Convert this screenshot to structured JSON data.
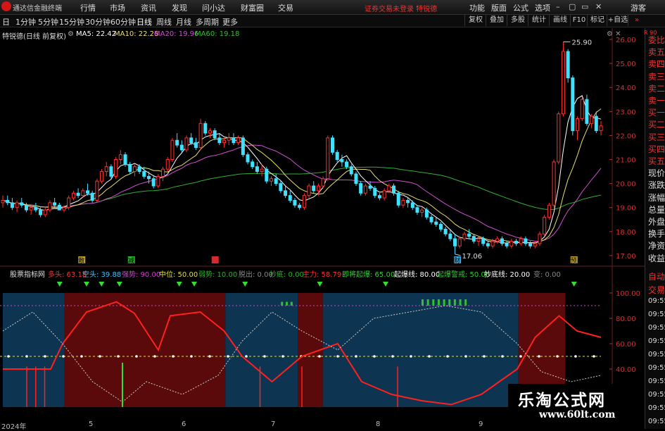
{
  "menubar": {
    "app_title": "通达信金融终端",
    "menus": [
      "行情",
      "市场",
      "资讯",
      "发现",
      "问小达",
      "财富圈",
      "交易"
    ],
    "account_notice": "证券交易未登录  特锐德",
    "right_menus": [
      "功能",
      "版面",
      "公式",
      "选项"
    ],
    "guest": "游客"
  },
  "toolbar": {
    "periods": [
      "日",
      "1分钟",
      "5分钟",
      "15分钟",
      "30分钟",
      "60分钟",
      "日线",
      "周线",
      "月线",
      "多周期",
      "更多"
    ],
    "active_period": "日线",
    "right_buttons": [
      "复权",
      "叠加",
      "多股",
      "统计",
      "画线",
      "F10",
      "标记",
      "+自选"
    ]
  },
  "main_chart": {
    "header": {
      "stock_label": "特锐德(日线 前复权)",
      "ma5": "MA5: 22.42",
      "ma10": "MA10: 22.26",
      "ma20": "MA20: 19.96",
      "ma60": "MA60: 19.18"
    },
    "ma_colors": {
      "ma5": "#ffffff",
      "ma10": "#e8e070",
      "ma20": "#d050d0",
      "ma60": "#30b030"
    },
    "price_ticks": [
      "26.00",
      "25.00",
      "24.00",
      "23.00",
      "22.00",
      "21.00",
      "20.00",
      "19.00",
      "18.00",
      "17.00"
    ],
    "high_label": "25.90",
    "low_label": "17.06",
    "event_markers": [
      "散",
      "减",
      "",
      "财",
      "预"
    ],
    "candles": [
      [
        19.2,
        19.5,
        19.0,
        19.3
      ],
      [
        19.3,
        19.5,
        19.1,
        19.2
      ],
      [
        19.2,
        19.4,
        18.9,
        19.0
      ],
      [
        19.0,
        19.3,
        18.8,
        19.2
      ],
      [
        19.2,
        19.4,
        19.0,
        19.1
      ],
      [
        19.1,
        19.2,
        18.8,
        18.9
      ],
      [
        18.9,
        19.1,
        18.7,
        19.0
      ],
      [
        19.0,
        19.2,
        18.8,
        18.9
      ],
      [
        18.9,
        19.0,
        18.6,
        18.7
      ],
      [
        18.7,
        19.0,
        18.6,
        18.9
      ],
      [
        18.9,
        19.3,
        18.8,
        19.2
      ],
      [
        19.2,
        19.4,
        19.0,
        19.1
      ],
      [
        19.1,
        19.2,
        18.9,
        18.9
      ],
      [
        18.9,
        19.1,
        18.8,
        19.0
      ],
      [
        19.0,
        19.5,
        18.9,
        19.4
      ],
      [
        19.4,
        19.7,
        19.3,
        19.6
      ],
      [
        19.6,
        19.8,
        19.4,
        19.5
      ],
      [
        19.5,
        19.8,
        19.4,
        19.7
      ],
      [
        19.7,
        20.0,
        19.5,
        19.6
      ],
      [
        19.6,
        19.7,
        19.2,
        19.3
      ],
      [
        19.3,
        20.2,
        19.2,
        20.1
      ],
      [
        20.1,
        20.6,
        20.0,
        20.5
      ],
      [
        20.5,
        20.9,
        20.3,
        20.7
      ],
      [
        20.7,
        20.8,
        20.2,
        20.3
      ],
      [
        20.3,
        21.1,
        20.2,
        21.0
      ],
      [
        21.0,
        21.4,
        20.8,
        21.2
      ],
      [
        21.2,
        21.3,
        20.7,
        20.8
      ],
      [
        20.8,
        20.9,
        20.4,
        20.5
      ],
      [
        20.5,
        20.8,
        20.3,
        20.7
      ],
      [
        20.7,
        20.8,
        20.4,
        20.5
      ],
      [
        20.5,
        20.7,
        20.2,
        20.3
      ],
      [
        20.3,
        20.5,
        20.0,
        20.2
      ],
      [
        20.2,
        20.3,
        19.8,
        19.9
      ],
      [
        19.9,
        20.4,
        19.8,
        20.3
      ],
      [
        20.3,
        20.7,
        20.1,
        20.6
      ],
      [
        20.6,
        21.1,
        20.5,
        21.0
      ],
      [
        21.0,
        21.9,
        20.9,
        21.8
      ],
      [
        21.8,
        22.1,
        21.5,
        21.6
      ],
      [
        21.6,
        21.8,
        21.3,
        21.4
      ],
      [
        21.4,
        22.0,
        21.3,
        21.9
      ],
      [
        21.9,
        22.1,
        21.6,
        21.7
      ],
      [
        21.7,
        21.9,
        21.4,
        21.5
      ],
      [
        21.5,
        22.7,
        21.4,
        22.5
      ],
      [
        22.5,
        22.6,
        22.0,
        22.1
      ],
      [
        22.1,
        22.3,
        21.9,
        22.2
      ],
      [
        22.2,
        22.3,
        21.8,
        21.9
      ],
      [
        21.9,
        22.1,
        21.6,
        21.7
      ],
      [
        21.7,
        21.9,
        21.5,
        21.8
      ],
      [
        21.8,
        22.1,
        21.6,
        21.9
      ],
      [
        21.9,
        22.1,
        21.6,
        21.7
      ],
      [
        21.7,
        22.0,
        21.6,
        21.9
      ],
      [
        21.9,
        22.0,
        21.1,
        21.2
      ],
      [
        21.2,
        21.3,
        20.8,
        20.9
      ],
      [
        20.9,
        21.0,
        20.6,
        20.7
      ],
      [
        20.7,
        20.9,
        20.4,
        20.5
      ],
      [
        20.5,
        20.8,
        20.3,
        20.6
      ],
      [
        20.6,
        20.7,
        20.0,
        20.1
      ],
      [
        20.1,
        20.3,
        19.9,
        20.2
      ],
      [
        20.2,
        20.4,
        19.9,
        20.0
      ],
      [
        20.0,
        20.1,
        19.6,
        19.7
      ],
      [
        19.7,
        19.9,
        19.4,
        19.5
      ],
      [
        19.5,
        19.7,
        19.2,
        19.3
      ],
      [
        19.3,
        19.4,
        19.0,
        19.1
      ],
      [
        19.1,
        19.2,
        18.9,
        19.0
      ],
      [
        19.0,
        19.6,
        18.9,
        19.5
      ],
      [
        19.5,
        20.0,
        19.4,
        19.9
      ],
      [
        19.9,
        20.1,
        19.6,
        19.7
      ],
      [
        19.7,
        20.0,
        19.5,
        19.9
      ],
      [
        19.9,
        20.3,
        19.8,
        20.2
      ],
      [
        20.2,
        22.0,
        20.1,
        21.9
      ],
      [
        21.9,
        22.0,
        21.2,
        21.3
      ],
      [
        21.3,
        21.4,
        20.9,
        21.0
      ],
      [
        21.0,
        21.2,
        20.7,
        20.9
      ],
      [
        20.9,
        21.0,
        20.6,
        20.7
      ],
      [
        20.7,
        20.8,
        20.3,
        20.4
      ],
      [
        20.4,
        20.5,
        19.9,
        20.0
      ],
      [
        20.0,
        20.1,
        19.5,
        19.6
      ],
      [
        19.6,
        20.0,
        19.5,
        19.9
      ],
      [
        19.9,
        20.1,
        19.7,
        19.8
      ],
      [
        19.8,
        19.9,
        19.4,
        19.5
      ],
      [
        19.5,
        19.6,
        19.3,
        19.4
      ],
      [
        19.4,
        19.8,
        19.3,
        19.7
      ],
      [
        19.7,
        20.0,
        19.6,
        19.9
      ],
      [
        19.9,
        20.0,
        19.5,
        19.6
      ],
      [
        19.6,
        19.7,
        19.0,
        19.1
      ],
      [
        19.1,
        19.4,
        19.0,
        19.3
      ],
      [
        19.3,
        19.4,
        19.0,
        19.2
      ],
      [
        19.2,
        19.3,
        18.9,
        19.0
      ],
      [
        19.0,
        19.1,
        18.7,
        18.8
      ],
      [
        18.8,
        19.0,
        18.6,
        18.9
      ],
      [
        18.9,
        19.0,
        18.5,
        18.6
      ],
      [
        18.6,
        18.7,
        18.3,
        18.4
      ],
      [
        18.4,
        18.6,
        18.2,
        18.3
      ],
      [
        18.3,
        18.4,
        18.0,
        18.1
      ],
      [
        18.1,
        18.2,
        17.8,
        17.9
      ],
      [
        17.9,
        18.1,
        17.6,
        17.7
      ],
      [
        17.7,
        17.9,
        17.06,
        17.4
      ],
      [
        17.4,
        17.8,
        17.3,
        17.7
      ],
      [
        17.7,
        18.0,
        17.6,
        17.9
      ],
      [
        17.9,
        18.1,
        17.7,
        17.8
      ],
      [
        17.8,
        17.9,
        17.5,
        17.6
      ],
      [
        17.6,
        17.8,
        17.4,
        17.7
      ],
      [
        17.7,
        17.8,
        17.4,
        17.5
      ],
      [
        17.5,
        17.6,
        17.3,
        17.4
      ],
      [
        17.4,
        17.7,
        17.3,
        17.6
      ],
      [
        17.6,
        17.8,
        17.5,
        17.7
      ],
      [
        17.7,
        17.8,
        17.4,
        17.5
      ],
      [
        17.5,
        17.6,
        17.3,
        17.4
      ],
      [
        17.4,
        17.7,
        17.3,
        17.6
      ],
      [
        17.6,
        17.7,
        17.4,
        17.5
      ],
      [
        17.5,
        17.8,
        17.4,
        17.7
      ],
      [
        17.7,
        17.8,
        17.4,
        17.5
      ],
      [
        17.5,
        17.6,
        17.3,
        17.4
      ],
      [
        17.4,
        17.6,
        17.3,
        17.5
      ],
      [
        17.5,
        18.0,
        17.4,
        17.9
      ],
      [
        17.9,
        18.7,
        17.8,
        18.6
      ],
      [
        18.6,
        19.2,
        18.5,
        19.1
      ],
      [
        19.1,
        21.0,
        19.0,
        20.9
      ],
      [
        20.9,
        23.0,
        20.8,
        22.9
      ],
      [
        22.9,
        25.9,
        22.8,
        25.5
      ],
      [
        25.5,
        25.6,
        24.2,
        24.4
      ],
      [
        24.4,
        24.5,
        22.0,
        22.2
      ],
      [
        22.2,
        22.8,
        21.8,
        22.7
      ],
      [
        22.7,
        23.6,
        22.6,
        23.5
      ],
      [
        23.5,
        23.7,
        22.4,
        22.5
      ],
      [
        22.5,
        22.9,
        22.3,
        22.8
      ],
      [
        22.8,
        23.0,
        22.1,
        22.2
      ],
      [
        22.2,
        22.6,
        22.0,
        22.4
      ]
    ]
  },
  "indicator": {
    "title": "股票指标网",
    "labels": [
      {
        "name": "多头",
        "value": "63.18",
        "color": "#ff3030"
      },
      {
        "name": "空头",
        "value": "39.88",
        "color": "#40c0ff"
      },
      {
        "name": "强势",
        "value": "90.00",
        "color": "#d040d0"
      },
      {
        "name": "中位",
        "value": "50.00",
        "color": "#e0e040"
      },
      {
        "name": "弱势",
        "value": "10.00",
        "color": "#30b030"
      },
      {
        "name": "脱出",
        "value": "0.00",
        "color": "#888888"
      },
      {
        "name": "抄底",
        "value": "0.00",
        "color": "#30b030"
      },
      {
        "name": "主力",
        "value": "58.79",
        "color": "#ff3030"
      },
      {
        "name": "即将起爆",
        "value": "65.00",
        "color": "#30d030"
      },
      {
        "name": "起爆线",
        "value": "80.00",
        "color": "#ffffff"
      },
      {
        "name": "起爆警戒",
        "value": "50.00",
        "color": "#30d030"
      },
      {
        "name": "抄底线",
        "value": "20.00",
        "color": "#ffffff"
      },
      {
        "name": "变",
        "value": "0.00",
        "color": "#888888"
      }
    ],
    "ticks": [
      "100.00",
      "80.00",
      "60.00",
      "40.00"
    ],
    "zones": [
      {
        "from": 0,
        "to": 0.103,
        "color": "#0d3450"
      },
      {
        "from": 0.103,
        "to": 0.372,
        "color": "#5a0a0a"
      },
      {
        "from": 0.372,
        "to": 0.493,
        "color": "#0d3450"
      },
      {
        "from": 0.493,
        "to": 0.535,
        "color": "#5a0a0a"
      },
      {
        "from": 0.535,
        "to": 0.862,
        "color": "#0d3450"
      },
      {
        "from": 0.862,
        "to": 0.94,
        "color": "#5a0a0a"
      }
    ]
  },
  "right_panel": {
    "tag": "R  90",
    "items": [
      "委比",
      "卖五",
      "卖四",
      "卖三",
      "卖二",
      "卖一",
      "买一",
      "买二",
      "买三",
      "买四",
      "买五",
      "现价",
      "涨跌",
      "涨幅",
      "总量",
      "外盘",
      "换手",
      "净资",
      "收益"
    ],
    "lower_items": [
      "自动",
      "交易",
      "09:55",
      "09:55",
      "09:55",
      "09:55",
      "09:55",
      "09:55",
      "09:55",
      "09:55",
      "09:55",
      "09:55"
    ]
  },
  "dates": [
    "2024年",
    "5",
    "6",
    "7",
    "8",
    "9"
  ],
  "watermark": {
    "line1": "乐淘公式网",
    "line2": "www.60lt.com"
  }
}
